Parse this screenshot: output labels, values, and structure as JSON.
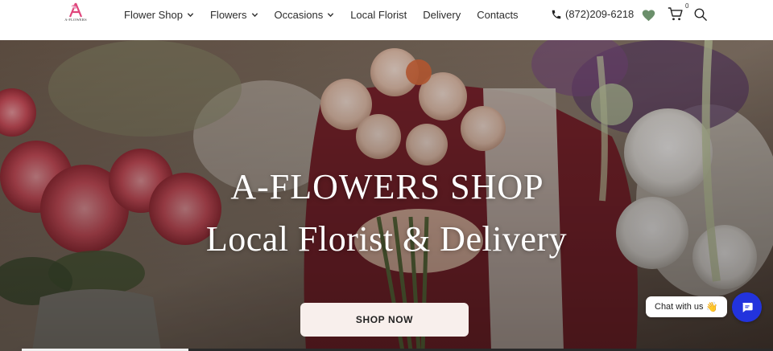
{
  "logo": {
    "text": "A-FLOWERS",
    "color": "#e0457b"
  },
  "nav": {
    "items": [
      {
        "label": "Flower Shop",
        "has_dropdown": true
      },
      {
        "label": "Flowers",
        "has_dropdown": true
      },
      {
        "label": "Occasions",
        "has_dropdown": true
      },
      {
        "label": "Local Florist",
        "has_dropdown": false
      },
      {
        "label": "Delivery",
        "has_dropdown": false
      },
      {
        "label": "Contacts",
        "has_dropdown": false
      }
    ]
  },
  "header_tools": {
    "phone": "(872)209-6218",
    "phone_icon": "phone-icon",
    "wishlist_icon": "heart-icon",
    "wishlist_color": "#6b8f6b",
    "cart_icon": "cart-icon",
    "cart_count": "0",
    "search_icon": "search-icon"
  },
  "hero": {
    "title": "A-FLOWERS SHOP",
    "subtitle": "Local Florist & Delivery",
    "cta_label": "SHOP NOW"
  },
  "chat": {
    "bubble_text": "Chat with us",
    "bubble_emoji": "👋",
    "button_icon": "chat-icon",
    "button_color": "#2233dd"
  }
}
